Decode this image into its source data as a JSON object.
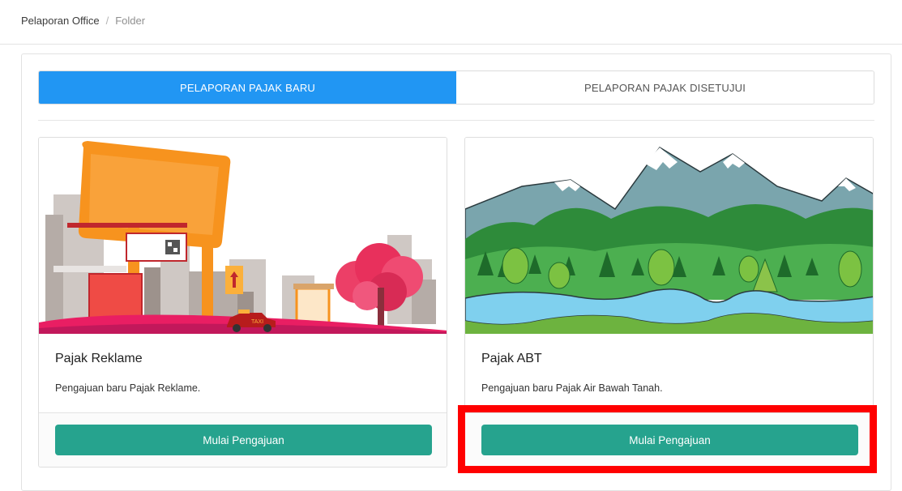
{
  "breadcrumb": {
    "root": "Pelaporan Office",
    "separator": "/",
    "current": "Folder"
  },
  "tabs": [
    {
      "label": "PELAPORAN PAJAK BARU",
      "active": true
    },
    {
      "label": "PELAPORAN PAJAK DISETUJUI",
      "active": false
    }
  ],
  "cards": [
    {
      "title": "Pajak Reklame",
      "description": "Pengajuan baru Pajak Reklame.",
      "button": "Mulai Pengajuan",
      "image": "billboard-city-illustration",
      "taxi_text": "TAXI"
    },
    {
      "title": "Pajak ABT",
      "description": "Pengajuan baru Pajak Air Bawah Tanah.",
      "button": "Mulai Pengajuan",
      "image": "mountain-forest-river-illustration"
    }
  ],
  "colors": {
    "accent": "#2196f3",
    "button": "#26a38e",
    "highlight": "#ff0000"
  }
}
